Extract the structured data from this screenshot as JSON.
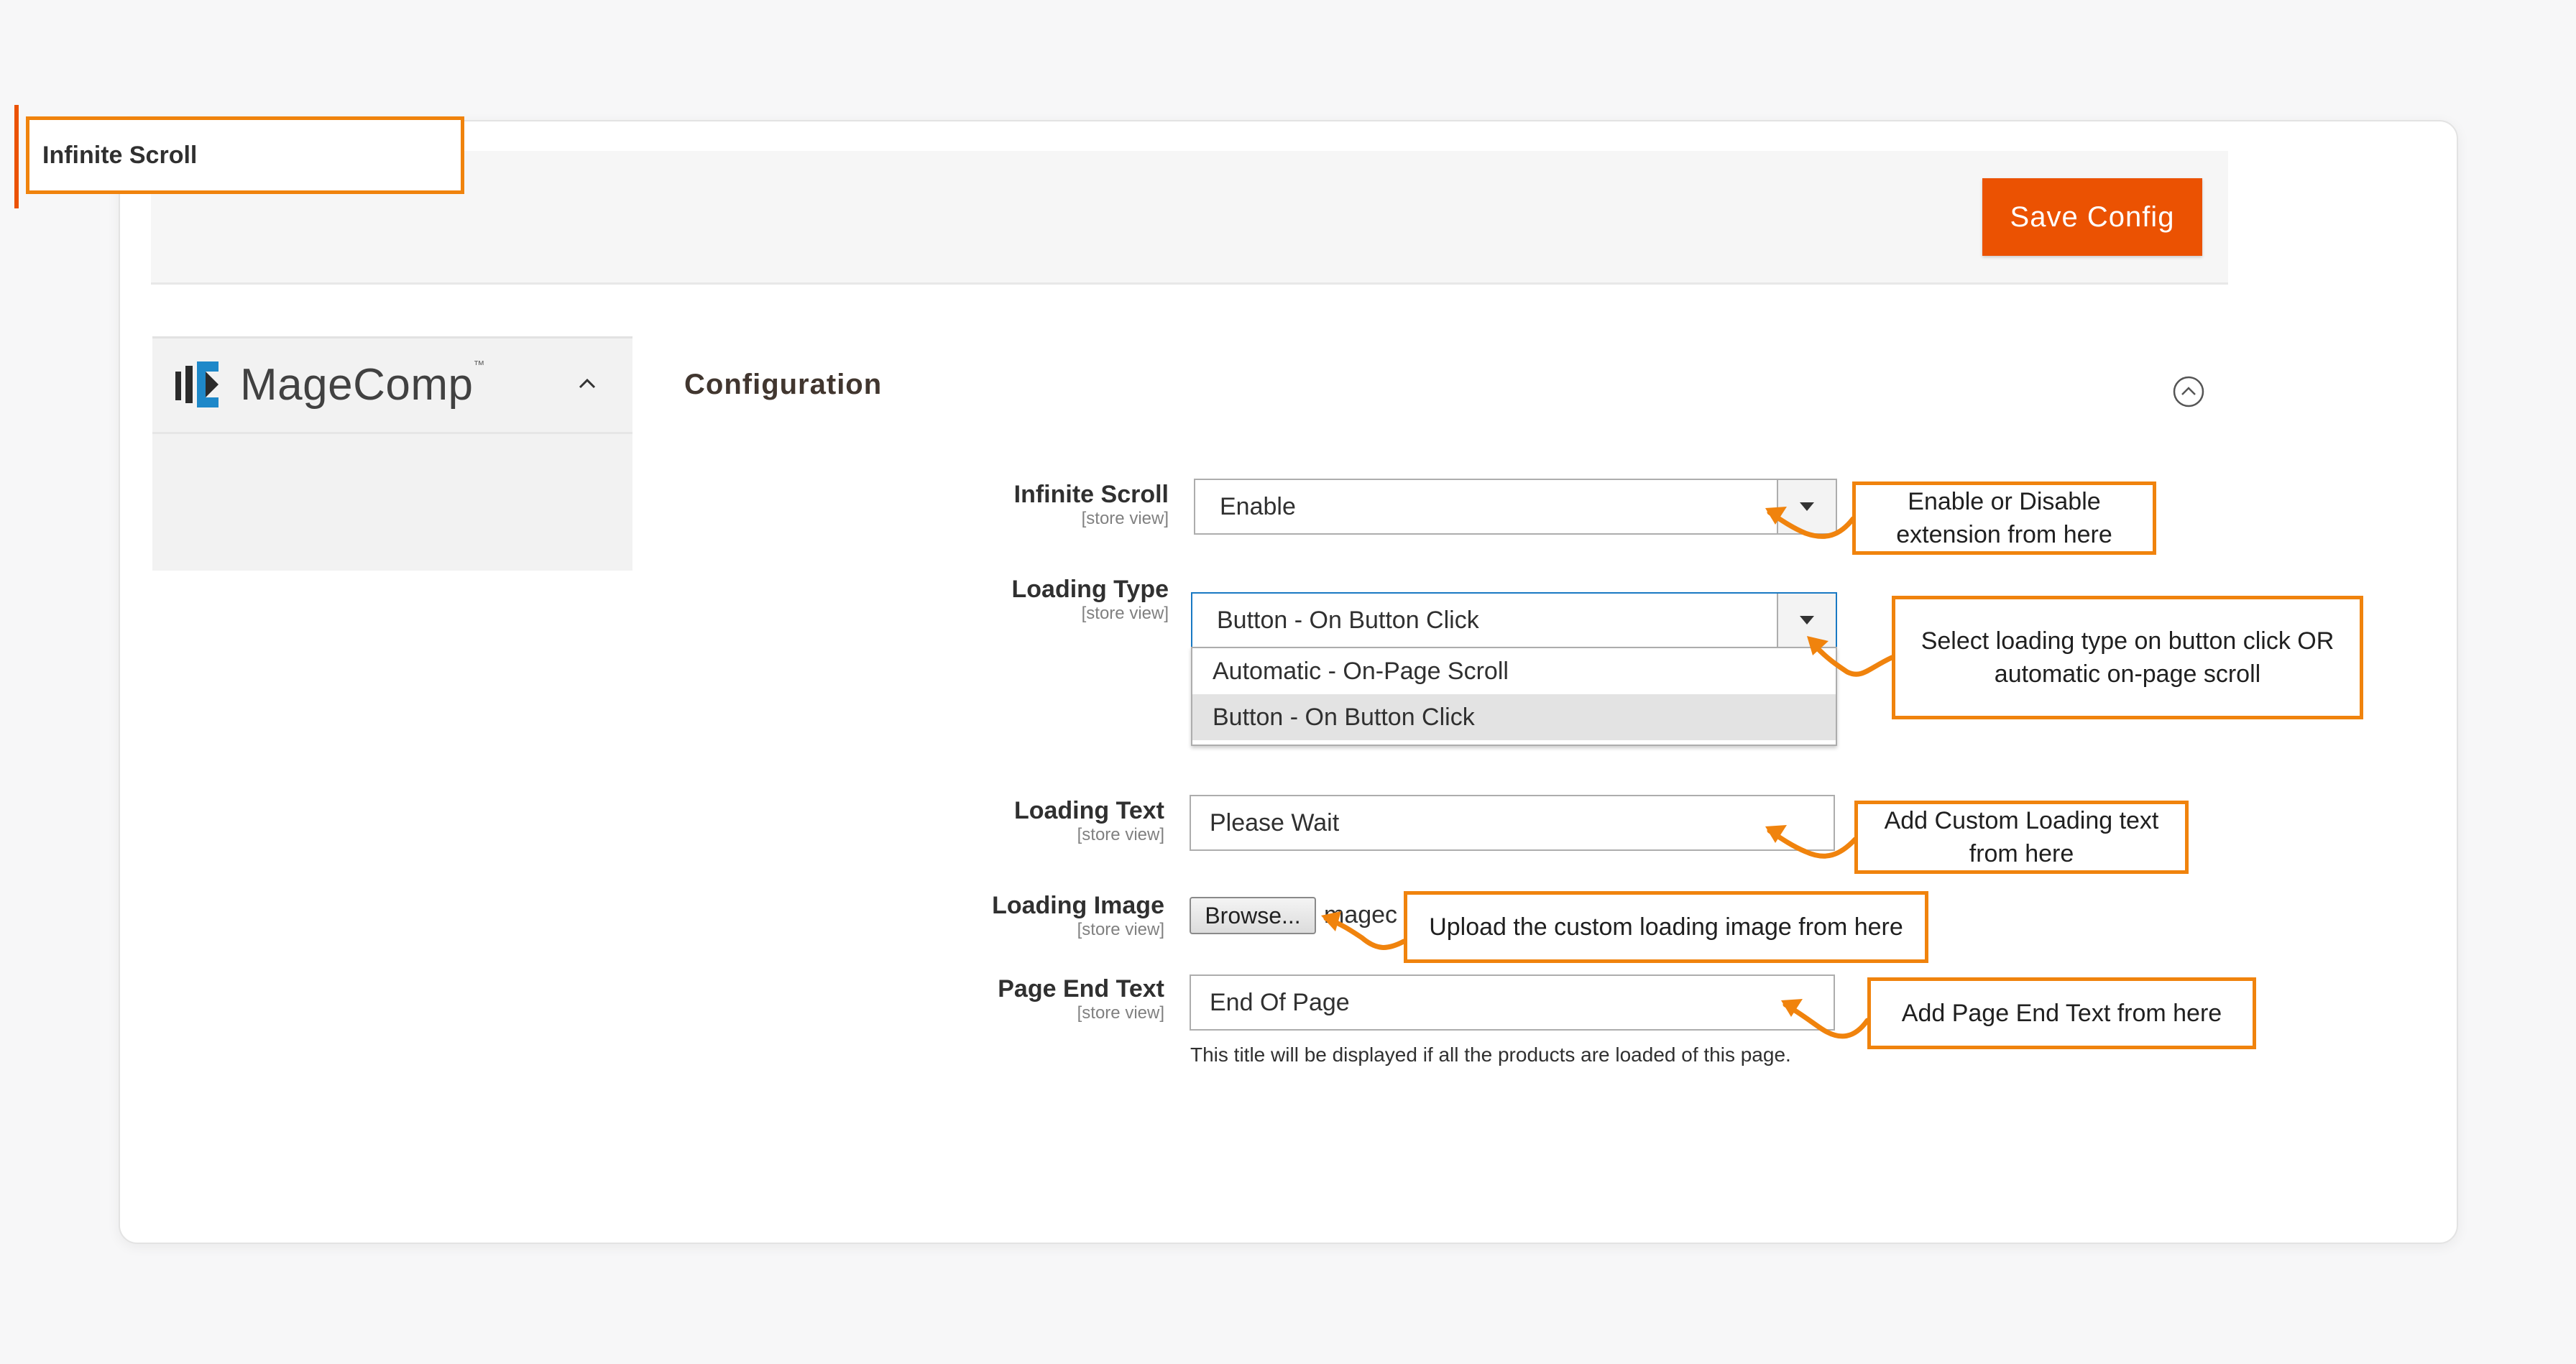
{
  "toolbar": {
    "save_label": "Save Config"
  },
  "sidebar": {
    "brand": "MageComp",
    "brand_tm": "™",
    "items": [
      {
        "label": "Infinite Scroll"
      }
    ]
  },
  "section": {
    "title": "Configuration"
  },
  "form": {
    "infinite_scroll": {
      "label": "Infinite Scroll",
      "scope": "[store view]",
      "value": "Enable"
    },
    "loading_type": {
      "label": "Loading Type",
      "scope": "[store view]",
      "value": "Button - On Button Click",
      "options": [
        "Automatic - On-Page Scroll",
        "Button - On Button Click"
      ]
    },
    "loading_text": {
      "label": "Loading Text",
      "scope": "[store view]",
      "value": "Please Wait"
    },
    "loading_image": {
      "label": "Loading Image",
      "scope": "[store view]",
      "browse_label": "Browse...",
      "file_text": "magec"
    },
    "page_end_text": {
      "label": "Page End Text",
      "scope": "[store view]",
      "value": "End Of Page",
      "note": "This title will be displayed if all the products are loaded of this page."
    }
  },
  "callouts": {
    "enable": "Enable or Disable extension from here",
    "loading_type": "Select loading type on button click OR automatic on-page scroll",
    "loading_text": "Add Custom Loading text from here",
    "loading_image": "Upload the custom loading image from here",
    "page_end": "Add Page End Text from here"
  },
  "colors": {
    "accent": "#eb5202",
    "callout_border": "#f0830d",
    "focus": "#1979c3"
  },
  "icons": {
    "collapse": "circle-chevron-up-icon",
    "sidebar_toggle": "chevron-up-icon",
    "dropdown": "caret-down-icon"
  }
}
